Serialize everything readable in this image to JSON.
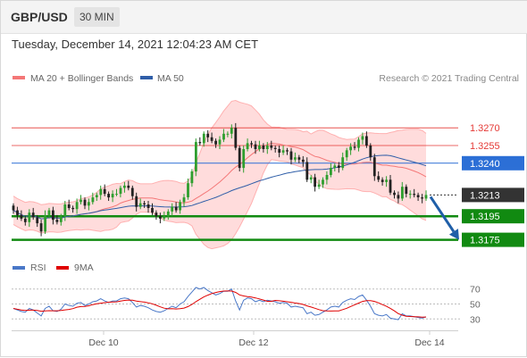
{
  "header": {
    "symbol": "GBP/USD",
    "timeframe": "30 MIN"
  },
  "timestamp": "Tuesday, December 14, 2021 12:04:23 AM CET",
  "legend": {
    "bollinger_label": "MA 20 + Bollinger Bands",
    "ma50_label": "MA 50",
    "credit": "Research © 2021 Trading Central",
    "rsi_label": "RSI",
    "rsi_ma_label": "9MA"
  },
  "colors": {
    "bollinger": "#f47777",
    "band_fill": "#ffdcdc",
    "ma50": "#2f5ea8",
    "resistance": "#e53935",
    "support": "#118a11",
    "pivot": "#2c6fd6",
    "current": "#333333",
    "arrow": "#1f5fa8",
    "rsi": "#4a78c8",
    "rsi_ma": "#e00000",
    "candle_up": "#2e9e2e",
    "candle_down": "#222222"
  },
  "chart_data": {
    "type": "candlestick",
    "x_labels": [
      "Dec 10",
      "Dec 12",
      "Dec 14"
    ],
    "ylim": [
      1.3158,
      1.3302
    ],
    "levels": [
      {
        "kind": "resistance",
        "value": 1.327,
        "label": "1.3270"
      },
      {
        "kind": "resistance",
        "value": 1.3255,
        "label": "1.3255"
      },
      {
        "kind": "pivot",
        "value": 1.324,
        "label": "1.3240"
      },
      {
        "kind": "current",
        "value": 1.3213,
        "label": "1.3213"
      },
      {
        "kind": "support",
        "value": 1.3195,
        "label": "1.3195"
      },
      {
        "kind": "support",
        "value": 1.3175,
        "label": "1.3175"
      }
    ],
    "closes": [
      1.32,
      1.3196,
      1.3193,
      1.319,
      1.3198,
      1.3194,
      1.3189,
      1.3182,
      1.3196,
      1.32,
      1.3192,
      1.319,
      1.3195,
      1.3205,
      1.3202,
      1.3201,
      1.3207,
      1.3209,
      1.3204,
      1.3207,
      1.3211,
      1.3213,
      1.3218,
      1.3214,
      1.3211,
      1.3214,
      1.3214,
      1.3219,
      1.3221,
      1.3219,
      1.3212,
      1.3203,
      1.3206,
      1.3205,
      1.3202,
      1.3198,
      1.3195,
      1.3193,
      1.3195,
      1.3199,
      1.3203,
      1.32,
      1.3207,
      1.3211,
      1.3223,
      1.3233,
      1.3258,
      1.3257,
      1.3265,
      1.3262,
      1.3259,
      1.3256,
      1.326,
      1.3265,
      1.3265,
      1.327,
      1.3253,
      1.3236,
      1.3252,
      1.3257,
      1.3256,
      1.3252,
      1.3255,
      1.3252,
      1.3255,
      1.3253,
      1.3252,
      1.3249,
      1.3251,
      1.325,
      1.3243,
      1.3245,
      1.3243,
      1.3241,
      1.3226,
      1.3228,
      1.322,
      1.3222,
      1.3226,
      1.323,
      1.3236,
      1.3238,
      1.3236,
      1.3245,
      1.3251,
      1.3254,
      1.3253,
      1.326,
      1.3263,
      1.3255,
      1.3245,
      1.3229,
      1.3226,
      1.3224,
      1.3226,
      1.3215,
      1.3213,
      1.321,
      1.322,
      1.3214,
      1.3214,
      1.3213,
      1.3211,
      1.321,
      1.3213
    ],
    "rsi": {
      "levels": [
        70,
        50,
        30
      ],
      "ylim": [
        22,
        78
      ],
      "values": [
        44,
        42,
        40,
        39,
        44,
        42,
        38,
        34,
        44,
        47,
        41,
        40,
        43,
        50,
        48,
        47,
        51,
        52,
        48,
        50,
        53,
        54,
        57,
        54,
        52,
        54,
        54,
        57,
        58,
        57,
        52,
        46,
        48,
        47,
        45,
        42,
        40,
        39,
        41,
        44,
        47,
        45,
        50,
        53,
        60,
        66,
        72,
        70,
        72,
        68,
        65,
        62,
        64,
        67,
        67,
        70,
        54,
        42,
        55,
        58,
        57,
        53,
        55,
        53,
        55,
        54,
        53,
        51,
        52,
        51,
        46,
        47,
        46,
        45,
        37,
        39,
        35,
        36,
        39,
        42,
        46,
        47,
        46,
        52,
        55,
        57,
        56,
        60,
        62,
        55,
        47,
        37,
        35,
        34,
        36,
        31,
        30,
        29,
        37,
        34,
        34,
        33,
        32,
        31,
        33
      ]
    }
  }
}
